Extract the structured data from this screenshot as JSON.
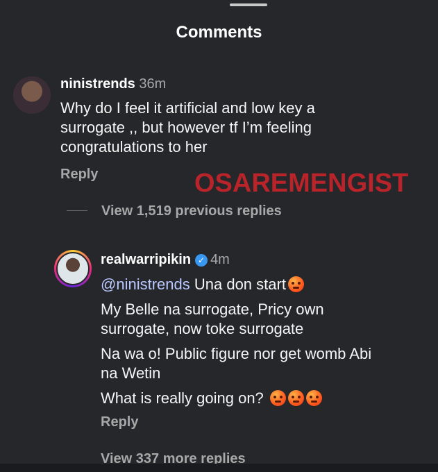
{
  "sheet": {
    "title": "Comments"
  },
  "comments": [
    {
      "username": "ninistrends",
      "time": "36m",
      "lines": [
        "Why do I feel it artificial and low key a",
        "surrogate ,, but however tf I’m feeling",
        "congratulations to her"
      ],
      "reply_label": "Reply",
      "view_replies_label": "View 1,519 previous replies"
    },
    {
      "username": "realwarripikin",
      "verified": true,
      "time": "4m",
      "mention": "@ninistrends",
      "first_line_rest": "Una don start",
      "lines": [
        "My Belle na surrogate, Pricy own",
        "surrogate, now toke surrogate",
        "Na wa o! Public figure nor get womb Abi",
        "na Wetin",
        "What is really going on?"
      ],
      "reply_label": "Reply",
      "view_replies_label": "View 337 more replies"
    }
  ],
  "watermark": "OSAREMENGIST",
  "icons": {
    "verified": "verified-badge-icon",
    "emoji": "angry-face-emoji"
  },
  "colors": {
    "background": "#26272b",
    "verified": "#3897f0",
    "watermark": "#b8242a",
    "mention": "#b8c8ff"
  }
}
